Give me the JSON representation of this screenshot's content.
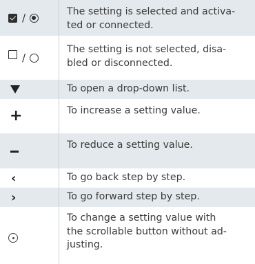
{
  "rows": [
    {
      "symbol": "checkbox-checked / radio-selected",
      "icon": "checked-checkbox-icon",
      "lines": [
        "The setting is selected and activa-",
        "ted or connected."
      ]
    },
    {
      "symbol": "checkbox-empty / radio-empty",
      "icon": "empty-checkbox-icon",
      "lines": [
        "The setting is not selected, disa-",
        "bled or disconnected."
      ]
    },
    {
      "symbol": "down-triangle",
      "icon": "dropdown-triangle-icon",
      "lines": [
        "To open a drop-down list."
      ]
    },
    {
      "symbol": "plus",
      "icon": "plus-icon",
      "lines": [
        "To increase a setting value."
      ]
    },
    {
      "symbol": "minus",
      "icon": "minus-icon",
      "lines": [
        "To reduce a setting value."
      ]
    },
    {
      "symbol": "chevron-left",
      "icon": "chevron-left-icon",
      "lines": [
        "To go back step by step."
      ]
    },
    {
      "symbol": "chevron-right",
      "icon": "chevron-right-icon",
      "lines": [
        "To go forward step by step."
      ]
    },
    {
      "symbol": "dial",
      "icon": "scroll-dial-icon",
      "lines": [
        "To change a setting value with",
        "the scrollable button without ad-",
        "justing."
      ]
    }
  ],
  "slash": "/",
  "plus_glyph": "+",
  "chevron_left_glyph": "‹",
  "chevron_right_glyph": "›"
}
